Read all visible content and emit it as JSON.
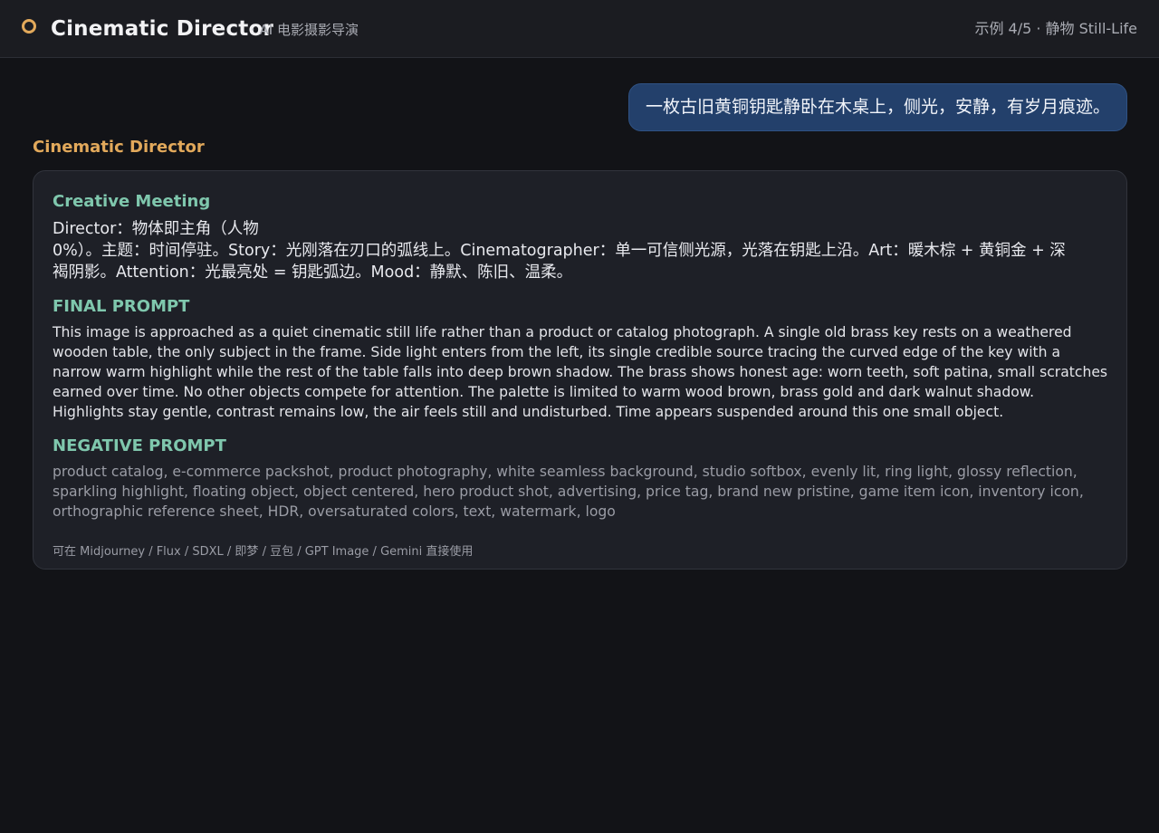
{
  "header": {
    "app_title": "Cinematic Director",
    "app_subtitle": "· AI 电影摄影导演",
    "example_label": "示例 4/5 · 静物 Still-Life",
    "logo_icon": "ring-logo-icon",
    "accent_color": "#e2a95b"
  },
  "chat": {
    "user_message": "一枚古旧黄铜钥匙静卧在木桌上，侧光，安静，有岁月痕迹。",
    "assistant_name": "Cinematic Director",
    "response": {
      "meeting_title": "Creative Meeting",
      "meeting_text_line1": "Director：物体即主角（人物",
      "meeting_text_rest": "0%）。主题：时间停驻。Story：光刚落在刃口的弧线上。Cinematographer：单一可信侧光源，光落在钥匙上沿。Art：暖木棕 + 黄铜金 + 深褐阴影。Attention：光最亮处 = 钥匙弧边。Mood：静默、陈旧、温柔。",
      "final_prompt_title": "FINAL PROMPT",
      "final_prompt_text": "This image is approached as a quiet cinematic still life rather than a product or catalog photograph. A single old brass key rests on a weathered wooden table, the only subject in the frame. Side light enters from the left, its single credible source tracing the curved edge of the key with a narrow warm highlight while the rest of the table falls into deep brown shadow. The brass shows honest age: worn teeth, soft patina, small scratches earned over time. No other objects compete for attention. The palette is limited to warm wood brown, brass gold and dark walnut shadow. Highlights stay gentle, contrast remains low, the air feels still and undisturbed. Time appears suspended around this one small object.",
      "negative_prompt_title": "NEGATIVE PROMPT",
      "negative_prompt_text": "product catalog, e-commerce packshot, product photography, white seamless background, studio softbox, evenly lit, ring light, glossy reflection, sparkling highlight, floating object, object centered, hero product shot, advertising, price tag, brand new pristine, game item icon, inventory icon, orthographic reference sheet, HDR, oversaturated colors, text, watermark, logo",
      "usage_note": "可在 Midjourney / Flux / SDXL / 即梦 / 豆包 / GPT Image / Gemini 直接使用"
    }
  }
}
